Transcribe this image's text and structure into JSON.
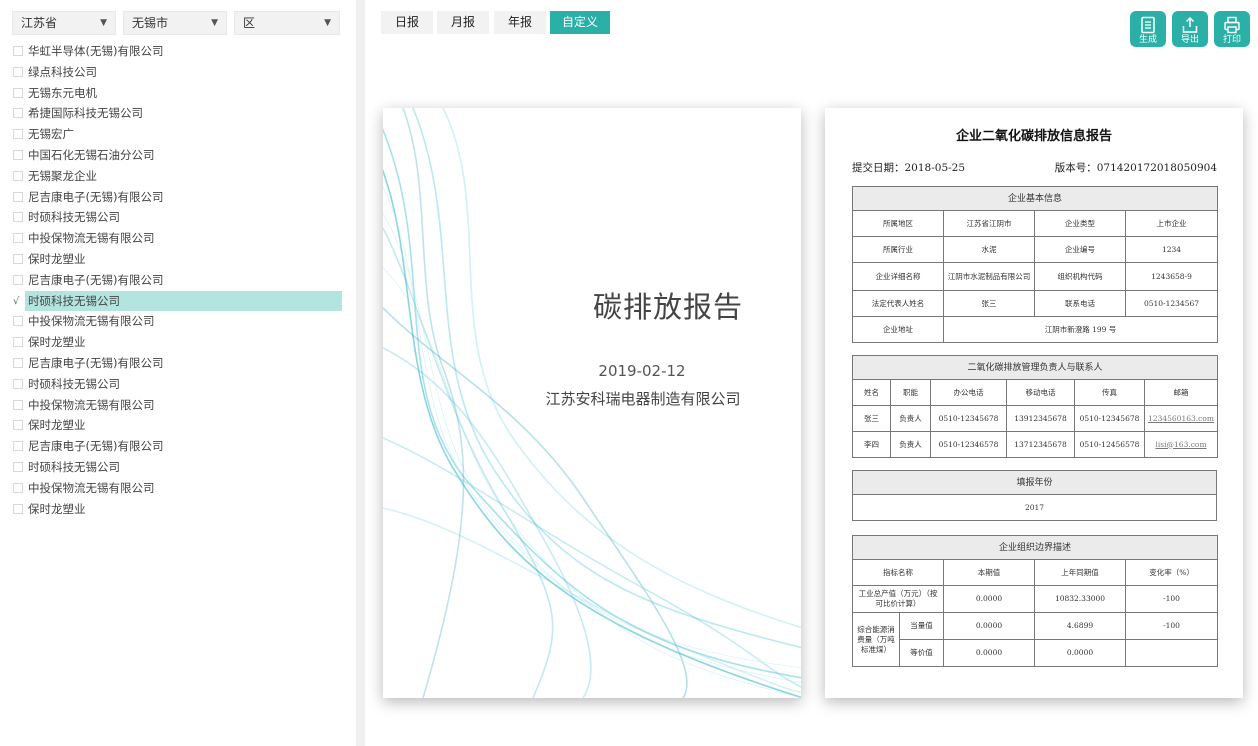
{
  "filters": {
    "province": "江苏省",
    "city": "无锡市",
    "district": "区"
  },
  "companies": [
    {
      "name": "华虹半导体(无锡)有限公司",
      "checked": false
    },
    {
      "name": "绿点科技公司",
      "checked": false
    },
    {
      "name": "无锡东元电机",
      "checked": false
    },
    {
      "name": "希捷国际科技无锡公司",
      "checked": false
    },
    {
      "name": "无锡宏广",
      "checked": false
    },
    {
      "name": "中国石化无锡石油分公司",
      "checked": false
    },
    {
      "name": "无锡聚龙企业",
      "checked": false
    },
    {
      "name": "尼吉康电子(无锡)有限公司",
      "checked": false
    },
    {
      "name": "时硕科技无锡公司",
      "checked": false
    },
    {
      "name": "中投保物流无锡有限公司",
      "checked": false
    },
    {
      "name": "保时龙塑业",
      "checked": false
    },
    {
      "name": "尼吉康电子(无锡)有限公司",
      "checked": false
    },
    {
      "name": "时硕科技无锡公司",
      "checked": true
    },
    {
      "name": "中投保物流无锡有限公司",
      "checked": false
    },
    {
      "name": "保时龙塑业",
      "checked": false
    },
    {
      "name": "尼吉康电子(无锡)有限公司",
      "checked": false
    },
    {
      "name": "时硕科技无锡公司",
      "checked": false
    },
    {
      "name": "中投保物流无锡有限公司",
      "checked": false
    },
    {
      "name": "保时龙塑业",
      "checked": false
    },
    {
      "name": "尼吉康电子(无锡)有限公司",
      "checked": false
    },
    {
      "name": "时硕科技无锡公司",
      "checked": false
    },
    {
      "name": "中投保物流无锡有限公司",
      "checked": false
    },
    {
      "name": "保时龙塑业",
      "checked": false
    }
  ],
  "check_mark": "√",
  "tabs": {
    "daily": "日报",
    "monthly": "月报",
    "yearly": "年报",
    "custom": "自定义",
    "active": "custom"
  },
  "actions": {
    "generate": "生成",
    "export": "导出",
    "print": "打印"
  },
  "colors": {
    "accent": "#2ab0a7",
    "selected_row": "#b3e4e0"
  },
  "cover": {
    "title": "碳排放报告",
    "date": "2019-02-12",
    "company": "江苏安科瑞电器制造有限公司"
  },
  "report": {
    "title": "企业二氧化碳排放信息报告",
    "submit_date": "提交日期：2018-05-25",
    "version": "版本号：071420172018050904",
    "basic": {
      "heading": "企业基本信息",
      "region_label": "所属地区",
      "region": "江苏省江阴市",
      "type_label": "企业类型",
      "type": "上市企业",
      "industry_label": "所属行业",
      "industry": "水泥",
      "code_label": "企业编号",
      "code": "1234",
      "fullname_label": "企业详细名称",
      "fullname": "江阴市水泥制品有限公司",
      "org_label": "组织机构代码",
      "org": "1243658-9",
      "legal_label": "法定代表人姓名",
      "legal": "张三",
      "phone_label": "联系电话",
      "phone": "0510-1234567",
      "address_label": "企业地址",
      "address": "江阴市新澄路 199 号"
    },
    "contacts": {
      "heading": "二氧化碳排放管理负责人与联系人",
      "columns": [
        "姓名",
        "职能",
        "办公电话",
        "移动电话",
        "传真",
        "邮箱"
      ],
      "rows": [
        [
          "张三",
          "负责人",
          "0510-12345678",
          "13912345678",
          "0510-12345678",
          "1234560163.com"
        ],
        [
          "李四",
          "负责人",
          "0510-12346578",
          "13712345678",
          "0510-12456578",
          "lisi@163.com"
        ]
      ]
    },
    "year": {
      "heading": "填报年份",
      "value": "2017"
    },
    "boundary": {
      "heading": "企业组织边界描述",
      "columns": [
        "指标名称",
        "本期值",
        "上年同期值",
        "变化率（%）"
      ],
      "output_label": "工业总产值（万元）（按可比价计算）",
      "output_current": "0.0000",
      "output_last": "10832.33000",
      "output_rate": "-100",
      "energy_label": "综合能源消费量（万吨标准煤）",
      "equiv_label": "当量值",
      "equiv_current": "0.0000",
      "equiv_last": "4.6899",
      "equiv_rate": "-100",
      "value_label": "等价值",
      "value_current": "0.0000",
      "value_last": "0.0000",
      "value_rate": ""
    }
  }
}
